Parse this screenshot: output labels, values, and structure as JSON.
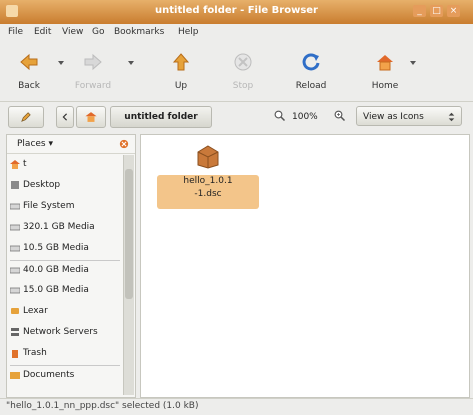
{
  "window": {
    "title": "untitled folder - File Browser",
    "controls": [
      "minimize-icon",
      "maximize-icon",
      "close-icon"
    ]
  },
  "menubar": {
    "items": [
      "File",
      "Edit",
      "View",
      "Go",
      "Bookmarks",
      "Help"
    ]
  },
  "toolbar": {
    "back": "Back",
    "forward": "Forward",
    "up": "Up",
    "stop": "Stop",
    "reload": "Reload",
    "home": "Home"
  },
  "location": {
    "current_folder": "untitled folder",
    "zoom": "100%",
    "view_mode": "View as Icons"
  },
  "sidebar": {
    "title": "Places",
    "items": [
      {
        "label": "t",
        "icon": "home-folder-icon"
      },
      {
        "label": "Desktop",
        "icon": "desktop-icon"
      },
      {
        "label": "File System",
        "icon": "drive-icon"
      },
      {
        "label": "320.1 GB Media",
        "icon": "drive-icon"
      },
      {
        "label": "10.5 GB Media",
        "icon": "drive-icon"
      },
      {
        "label": "40.0 GB Media",
        "icon": "drive-icon"
      },
      {
        "label": "15.0 GB Media",
        "icon": "drive-icon"
      },
      {
        "label": "Lexar",
        "icon": "usb-drive-icon"
      },
      {
        "label": "Network Servers",
        "icon": "network-icon"
      },
      {
        "label": "Trash",
        "icon": "trash-icon"
      },
      {
        "label": "Documents",
        "icon": "folder-icon"
      }
    ]
  },
  "content": {
    "files": [
      {
        "name_line1": "hello_1.0.1",
        "name_line2": "-1.dsc"
      }
    ]
  },
  "statusbar": {
    "text": "\"hello_1.0.1_nn_ppp.dsc\" selected (1.0 kB)"
  },
  "colors": {
    "titlebar": "#d58b3b",
    "selection": "#f3c58a",
    "accent_orange": "#e07a2e"
  }
}
